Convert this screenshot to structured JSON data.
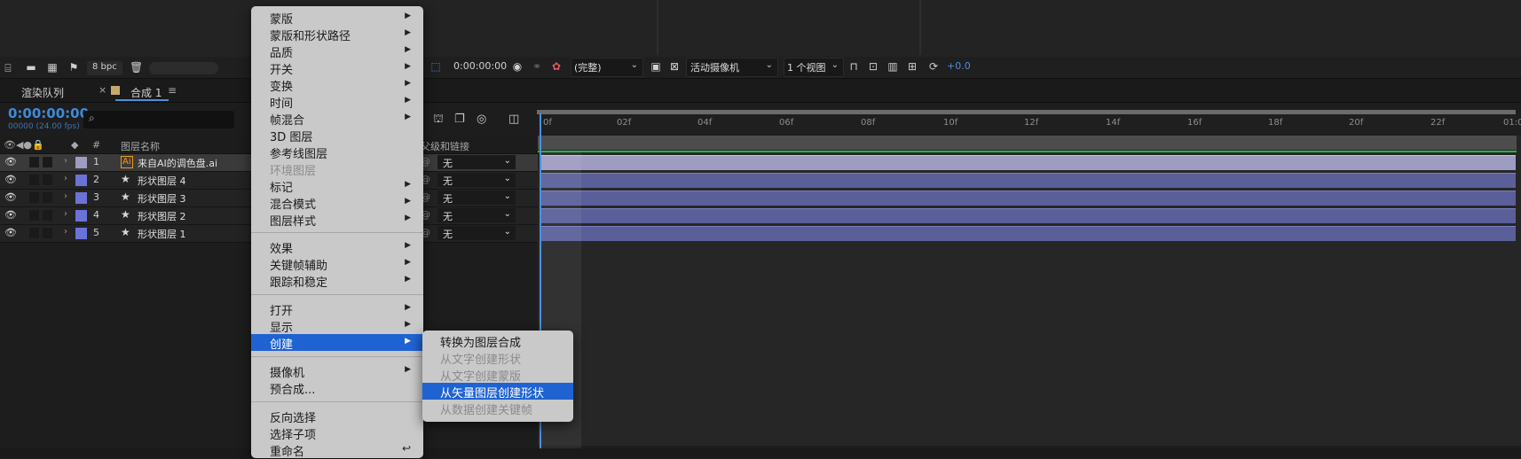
{
  "viewer_toolbar": {
    "bpc_label": "8 bpc",
    "timecode": "0:00:00:00",
    "resolution": "(完整)",
    "camera": "活动摄像机",
    "views": "1 个视图",
    "exposure": "+0.0"
  },
  "tabs": {
    "render_queue": "渲染队列",
    "composition": "合成 1"
  },
  "timeline": {
    "current_time": "0:00:00:00",
    "frame_info": "00000 (24.00 fps)",
    "search_icon": "search-icon"
  },
  "columns": {
    "number": "#",
    "layer_name": "图层名称",
    "parent_link": "父级和链接"
  },
  "layers": [
    {
      "num": "1",
      "name": "来自AI的调色盘.ai",
      "parent": "无",
      "color": "#9f9cc1",
      "icon": "ai-file-icon"
    },
    {
      "num": "2",
      "name": "形状图层 4",
      "parent": "无",
      "color": "#6b73d9",
      "icon": "star-icon"
    },
    {
      "num": "3",
      "name": "形状图层 3",
      "parent": "无",
      "color": "#6b73d9",
      "icon": "star-icon"
    },
    {
      "num": "4",
      "name": "形状图层 2",
      "parent": "无",
      "color": "#6b73d9",
      "icon": "star-icon"
    },
    {
      "num": "5",
      "name": "形状图层 1",
      "parent": "无",
      "color": "#6b73d9",
      "icon": "star-icon"
    }
  ],
  "ruler_ticks": [
    "0f",
    "02f",
    "04f",
    "06f",
    "08f",
    "10f",
    "12f",
    "14f",
    "16f",
    "18f",
    "20f",
    "22f",
    "01:0"
  ],
  "context_menu": {
    "items": [
      {
        "label": "蒙版",
        "sub": "▶"
      },
      {
        "label": "蒙版和形状路径",
        "sub": "▶"
      },
      {
        "label": "品质",
        "sub": "▶"
      },
      {
        "label": "开关",
        "sub": "▶"
      },
      {
        "label": "变换",
        "sub": "▶"
      },
      {
        "label": "时间",
        "sub": "▶"
      },
      {
        "label": "帧混合",
        "sub": "▶"
      },
      {
        "label": "3D 图层",
        "sub": ""
      },
      {
        "label": "参考线图层",
        "sub": ""
      },
      {
        "label": "环境图层",
        "sub": ""
      },
      {
        "label": "标记",
        "sub": "▶"
      },
      {
        "label": "混合模式",
        "sub": "▶"
      },
      {
        "label": "图层样式",
        "sub": "▶"
      },
      {
        "label": "效果",
        "sub": "▶"
      },
      {
        "label": "关键帧辅助",
        "sub": "▶"
      },
      {
        "label": "跟踪和稳定",
        "sub": "▶"
      },
      {
        "label": "打开",
        "sub": "▶"
      },
      {
        "label": "显示",
        "sub": "▶"
      },
      {
        "label": "创建",
        "sub": "▶"
      },
      {
        "label": "摄像机",
        "sub": "▶"
      },
      {
        "label": "预合成...",
        "sub": ""
      },
      {
        "label": "反向选择",
        "sub": ""
      },
      {
        "label": "选择子项",
        "sub": ""
      },
      {
        "label": "重命名",
        "sub": "↩"
      }
    ]
  },
  "submenu": {
    "items": [
      {
        "label": "转换为图层合成"
      },
      {
        "label": "从文字创建形状"
      },
      {
        "label": "从文字创建蒙版"
      },
      {
        "label": "从矢量图层创建形状"
      },
      {
        "label": "从数据创建关键帧"
      }
    ]
  }
}
